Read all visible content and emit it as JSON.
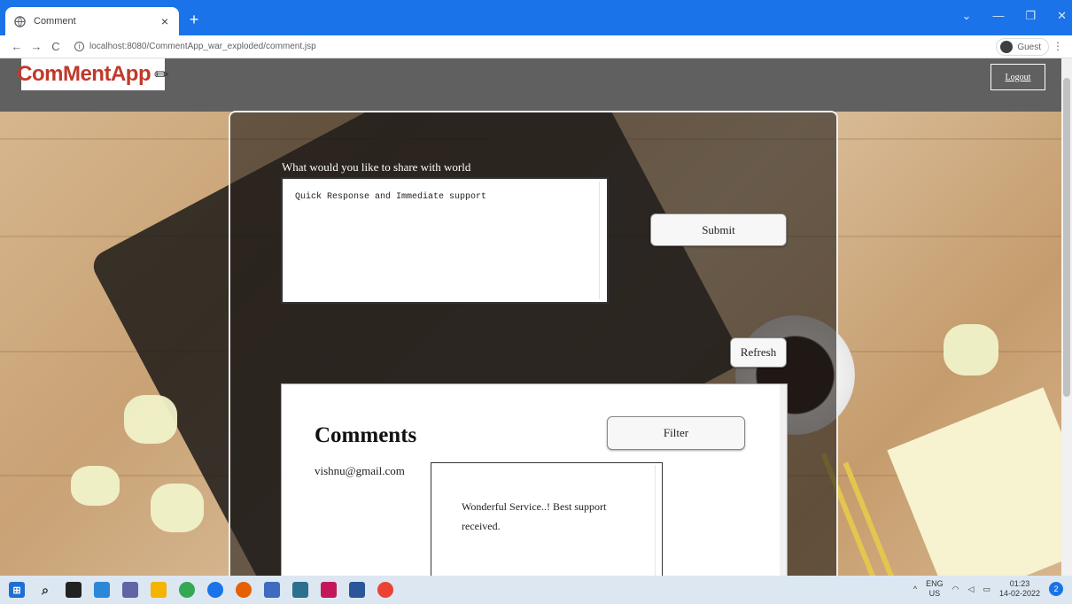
{
  "browser": {
    "tab_title": "Comment",
    "tab_close": "×",
    "new_tab": "+",
    "url": "localhost:8080/CommentApp_war_exploded/comment.jsp",
    "profile_label": "Guest",
    "window_controls": {
      "minimize": "—",
      "restore": "❐",
      "close": "✕",
      "tabsearch": "⌄"
    }
  },
  "header": {
    "logo_text": "ComMentApp",
    "logout_label": "Logout"
  },
  "form": {
    "share_label": "What would you like to share with world",
    "share_value": "Quick Response and Immediate support",
    "submit_label": "Submit",
    "refresh_label": "Refresh"
  },
  "comments": {
    "title": "Comments",
    "filter_label": "Filter",
    "items": [
      {
        "email": "vishnu@gmail.com",
        "text": "Wonderful Service..! Best support received."
      }
    ]
  },
  "taskbar": {
    "lang_line1": "ENG",
    "lang_line2": "US",
    "time": "01:23",
    "date": "14-02-2022",
    "tray_chevron": "^"
  },
  "colors": {
    "tabbar": "#1a73e8",
    "header": "#606060",
    "logo_text": "#c0392b",
    "taskbar": "#dce7f2"
  }
}
